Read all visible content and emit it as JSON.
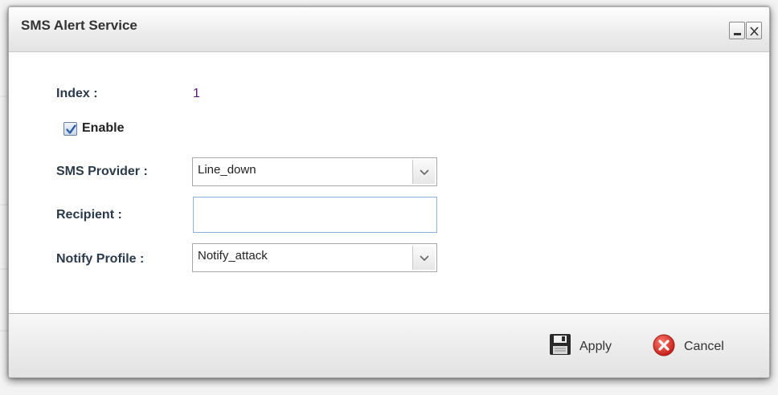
{
  "dialog": {
    "title": "SMS Alert Service",
    "minimize_icon": "minimize-icon",
    "close_icon": "close-icon"
  },
  "form": {
    "index_label": "Index :",
    "index_value": "1",
    "enable_label": "Enable",
    "enable_checked": true,
    "sms_provider_label": "SMS Provider :",
    "sms_provider_value": "Line_down",
    "recipient_label": "Recipient :",
    "recipient_value": "",
    "notify_profile_label": "Notify Profile :",
    "notify_profile_value": "Notify_attack"
  },
  "footer": {
    "apply_label": "Apply",
    "apply_icon": "save-icon",
    "cancel_label": "Cancel",
    "cancel_icon": "cancel-icon"
  },
  "colors": {
    "index_value": "#5b1a6e",
    "label": "#2b3a4a",
    "cancel_red": "#d9312b",
    "input_border": "#8fb2d8"
  }
}
